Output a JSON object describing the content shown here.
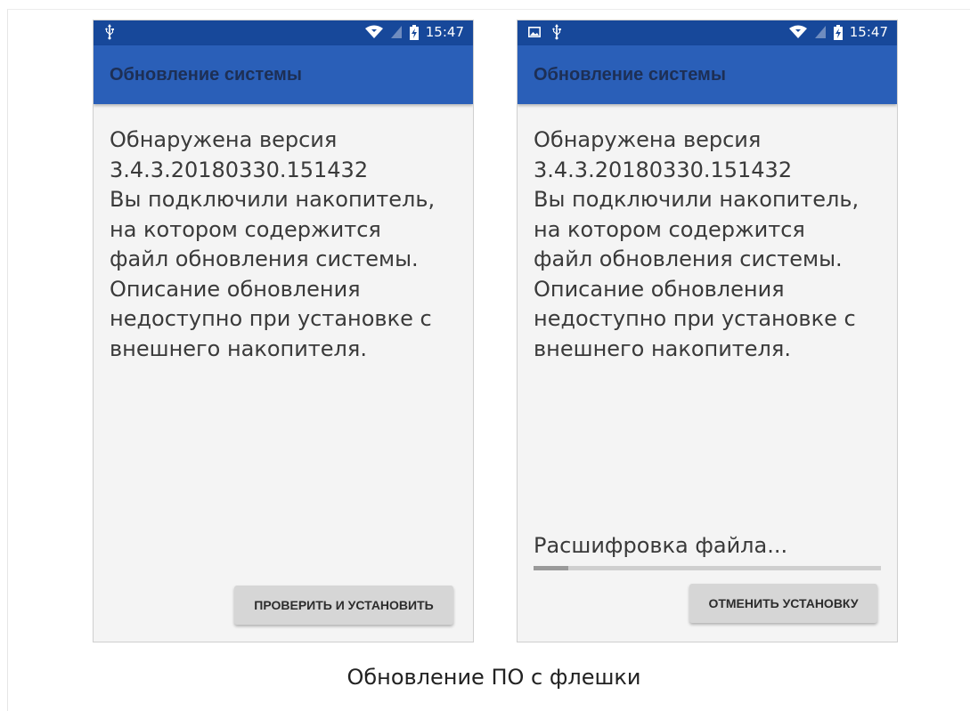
{
  "screens": [
    {
      "status_time": "15:47",
      "title": "Обновление системы",
      "lines": [
        "Обнаружена версия",
        "3.4.3.20180330.151432",
        "Вы подключили накопитель,",
        "на котором содержится",
        "файл обновления системы.",
        "Описание обновления",
        "недоступно при установке с",
        "внешнего накопителя."
      ],
      "button_label": "ПРОВЕРИТЬ И УСТАНОВИТЬ"
    },
    {
      "status_time": "15:47",
      "title": "Обновление системы",
      "lines": [
        "Обнаружена версия",
        "3.4.3.20180330.151432",
        "Вы подключили накопитель,",
        "на котором содержится",
        "файл обновления системы.",
        "Описание обновления",
        "недоступно при установке с",
        "внешнего накопителя."
      ],
      "progress_label": "Расшифровка файла...",
      "progress_fraction": 0.1,
      "button_label": "ОТМЕНИТЬ УСТАНОВКУ"
    }
  ],
  "caption": "Обновление ПО с флешки",
  "colors": {
    "statusbar": "#17489a",
    "appbar": "#2a5fb8",
    "background": "#f4f4f4",
    "button": "#d6d6d6"
  },
  "icons": [
    "usb-icon",
    "image-icon",
    "wifi-icon",
    "no-sim-icon",
    "battery-charging-icon"
  ]
}
